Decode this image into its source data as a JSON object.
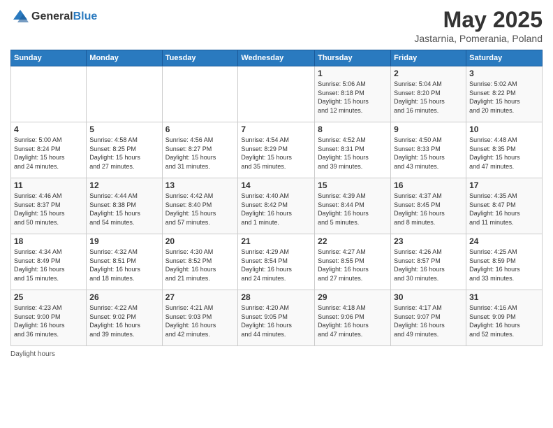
{
  "logo": {
    "general": "General",
    "blue": "Blue"
  },
  "title": "May 2025",
  "subtitle": "Jastarnia, Pomerania, Poland",
  "days_header": [
    "Sunday",
    "Monday",
    "Tuesday",
    "Wednesday",
    "Thursday",
    "Friday",
    "Saturday"
  ],
  "footer": "Daylight hours",
  "weeks": [
    [
      {
        "day": "",
        "info": ""
      },
      {
        "day": "",
        "info": ""
      },
      {
        "day": "",
        "info": ""
      },
      {
        "day": "",
        "info": ""
      },
      {
        "day": "1",
        "info": "Sunrise: 5:06 AM\nSunset: 8:18 PM\nDaylight: 15 hours\nand 12 minutes."
      },
      {
        "day": "2",
        "info": "Sunrise: 5:04 AM\nSunset: 8:20 PM\nDaylight: 15 hours\nand 16 minutes."
      },
      {
        "day": "3",
        "info": "Sunrise: 5:02 AM\nSunset: 8:22 PM\nDaylight: 15 hours\nand 20 minutes."
      }
    ],
    [
      {
        "day": "4",
        "info": "Sunrise: 5:00 AM\nSunset: 8:24 PM\nDaylight: 15 hours\nand 24 minutes."
      },
      {
        "day": "5",
        "info": "Sunrise: 4:58 AM\nSunset: 8:25 PM\nDaylight: 15 hours\nand 27 minutes."
      },
      {
        "day": "6",
        "info": "Sunrise: 4:56 AM\nSunset: 8:27 PM\nDaylight: 15 hours\nand 31 minutes."
      },
      {
        "day": "7",
        "info": "Sunrise: 4:54 AM\nSunset: 8:29 PM\nDaylight: 15 hours\nand 35 minutes."
      },
      {
        "day": "8",
        "info": "Sunrise: 4:52 AM\nSunset: 8:31 PM\nDaylight: 15 hours\nand 39 minutes."
      },
      {
        "day": "9",
        "info": "Sunrise: 4:50 AM\nSunset: 8:33 PM\nDaylight: 15 hours\nand 43 minutes."
      },
      {
        "day": "10",
        "info": "Sunrise: 4:48 AM\nSunset: 8:35 PM\nDaylight: 15 hours\nand 47 minutes."
      }
    ],
    [
      {
        "day": "11",
        "info": "Sunrise: 4:46 AM\nSunset: 8:37 PM\nDaylight: 15 hours\nand 50 minutes."
      },
      {
        "day": "12",
        "info": "Sunrise: 4:44 AM\nSunset: 8:38 PM\nDaylight: 15 hours\nand 54 minutes."
      },
      {
        "day": "13",
        "info": "Sunrise: 4:42 AM\nSunset: 8:40 PM\nDaylight: 15 hours\nand 57 minutes."
      },
      {
        "day": "14",
        "info": "Sunrise: 4:40 AM\nSunset: 8:42 PM\nDaylight: 16 hours\nand 1 minute."
      },
      {
        "day": "15",
        "info": "Sunrise: 4:39 AM\nSunset: 8:44 PM\nDaylight: 16 hours\nand 5 minutes."
      },
      {
        "day": "16",
        "info": "Sunrise: 4:37 AM\nSunset: 8:45 PM\nDaylight: 16 hours\nand 8 minutes."
      },
      {
        "day": "17",
        "info": "Sunrise: 4:35 AM\nSunset: 8:47 PM\nDaylight: 16 hours\nand 11 minutes."
      }
    ],
    [
      {
        "day": "18",
        "info": "Sunrise: 4:34 AM\nSunset: 8:49 PM\nDaylight: 16 hours\nand 15 minutes."
      },
      {
        "day": "19",
        "info": "Sunrise: 4:32 AM\nSunset: 8:51 PM\nDaylight: 16 hours\nand 18 minutes."
      },
      {
        "day": "20",
        "info": "Sunrise: 4:30 AM\nSunset: 8:52 PM\nDaylight: 16 hours\nand 21 minutes."
      },
      {
        "day": "21",
        "info": "Sunrise: 4:29 AM\nSunset: 8:54 PM\nDaylight: 16 hours\nand 24 minutes."
      },
      {
        "day": "22",
        "info": "Sunrise: 4:27 AM\nSunset: 8:55 PM\nDaylight: 16 hours\nand 27 minutes."
      },
      {
        "day": "23",
        "info": "Sunrise: 4:26 AM\nSunset: 8:57 PM\nDaylight: 16 hours\nand 30 minutes."
      },
      {
        "day": "24",
        "info": "Sunrise: 4:25 AM\nSunset: 8:59 PM\nDaylight: 16 hours\nand 33 minutes."
      }
    ],
    [
      {
        "day": "25",
        "info": "Sunrise: 4:23 AM\nSunset: 9:00 PM\nDaylight: 16 hours\nand 36 minutes."
      },
      {
        "day": "26",
        "info": "Sunrise: 4:22 AM\nSunset: 9:02 PM\nDaylight: 16 hours\nand 39 minutes."
      },
      {
        "day": "27",
        "info": "Sunrise: 4:21 AM\nSunset: 9:03 PM\nDaylight: 16 hours\nand 42 minutes."
      },
      {
        "day": "28",
        "info": "Sunrise: 4:20 AM\nSunset: 9:05 PM\nDaylight: 16 hours\nand 44 minutes."
      },
      {
        "day": "29",
        "info": "Sunrise: 4:18 AM\nSunset: 9:06 PM\nDaylight: 16 hours\nand 47 minutes."
      },
      {
        "day": "30",
        "info": "Sunrise: 4:17 AM\nSunset: 9:07 PM\nDaylight: 16 hours\nand 49 minutes."
      },
      {
        "day": "31",
        "info": "Sunrise: 4:16 AM\nSunset: 9:09 PM\nDaylight: 16 hours\nand 52 minutes."
      }
    ]
  ]
}
